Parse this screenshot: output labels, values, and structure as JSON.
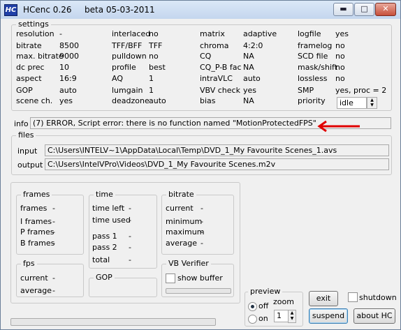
{
  "titlebar": {
    "logo": "HC",
    "app_name": "HCenc 0.26",
    "version": "beta 05-03-2011",
    "minimize_icon": "minimize-icon",
    "maximize_icon": "maximize-icon",
    "close_icon": "close-icon"
  },
  "settings": {
    "title": "settings",
    "col1": [
      {
        "label": "resolution",
        "value": "-"
      },
      {
        "label": "bitrate",
        "value": "8500"
      },
      {
        "label": "max. bitrate",
        "value": "9000"
      },
      {
        "label": "dc prec",
        "value": "10"
      },
      {
        "label": "aspect",
        "value": "16:9"
      },
      {
        "label": "GOP",
        "value": "auto"
      },
      {
        "label": "scene ch.",
        "value": "yes"
      }
    ],
    "col2": [
      {
        "label": "interlaced",
        "value": "no"
      },
      {
        "label": "TFF/BFF",
        "value": "TFF"
      },
      {
        "label": "pulldown",
        "value": "no"
      },
      {
        "label": "profile",
        "value": "best"
      },
      {
        "label": "AQ",
        "value": "1"
      },
      {
        "label": "lumgain",
        "value": "1"
      },
      {
        "label": "deadzone",
        "value": "auto"
      }
    ],
    "col3": [
      {
        "label": "matrix",
        "value": "adaptive"
      },
      {
        "label": "chroma",
        "value": "4:2:0"
      },
      {
        "label": "CQ",
        "value": "NA"
      },
      {
        "label": "CQ_P-B fac",
        "value": "NA"
      },
      {
        "label": "intraVLC",
        "value": "auto"
      },
      {
        "label": "VBV check",
        "value": "yes"
      },
      {
        "label": "bias",
        "value": "NA"
      }
    ],
    "col4": [
      {
        "label": "logfile",
        "value": "yes"
      },
      {
        "label": "framelog",
        "value": "no"
      },
      {
        "label": "SCD file",
        "value": "no"
      },
      {
        "label": "mask/shift",
        "value": "no"
      },
      {
        "label": "lossless",
        "value": "no"
      },
      {
        "label": "SMP",
        "value": "yes,  proc = 2"
      },
      {
        "label": "priority",
        "value": "idle"
      }
    ]
  },
  "info": {
    "label": "info",
    "message": "(7) ERROR, Script error: there is no function named \"MotionProtectedFPS\"",
    "arrow_color": "#e00000"
  },
  "files": {
    "title": "files",
    "input_label": "input",
    "input_value": "C:\\Users\\INTELV~1\\AppData\\Local\\Temp\\DVD_1_My Favourite Scenes_1.avs",
    "output_label": "output",
    "output_value": "C:\\Users\\IntelVPro\\Videos\\DVD_1_My Favourite Scenes.m2v"
  },
  "frames": {
    "title": "frames",
    "rows": [
      {
        "label": "frames",
        "value": "-"
      },
      {
        "label": "I frames",
        "value": "-"
      },
      {
        "label": "P frames",
        "value": "-"
      },
      {
        "label": "B frames",
        "value": "-"
      }
    ]
  },
  "time": {
    "title": "time",
    "rows": [
      {
        "label": "time left",
        "value": "-"
      },
      {
        "label": "time used",
        "value": "-"
      },
      {
        "label": "pass 1",
        "value": "-"
      },
      {
        "label": "pass 2",
        "value": "-"
      },
      {
        "label": "total",
        "value": "-"
      }
    ]
  },
  "bitrate": {
    "title": "bitrate",
    "rows": [
      {
        "label": "current",
        "value": "-"
      },
      {
        "label": "minimum",
        "value": "-"
      },
      {
        "label": "maximum",
        "value": "-"
      },
      {
        "label": "average",
        "value": "-"
      }
    ]
  },
  "fps": {
    "title": "fps",
    "rows": [
      {
        "label": "current",
        "value": "-"
      },
      {
        "label": "average",
        "value": "-"
      }
    ]
  },
  "gop": {
    "title": "GOP"
  },
  "vbv": {
    "title": "VB Verifier",
    "show_buffer_label": "show buffer",
    "show_buffer_checked": false
  },
  "preview": {
    "title": "preview",
    "zoom_label": "zoom",
    "off_label": "off",
    "on_label": "on",
    "selected": "off",
    "zoom_value": "1"
  },
  "buttons": {
    "exit": "exit",
    "suspend": "suspend",
    "about": "about  HC",
    "shutdown": "shutdown"
  },
  "progress": {
    "fraction": 0
  }
}
